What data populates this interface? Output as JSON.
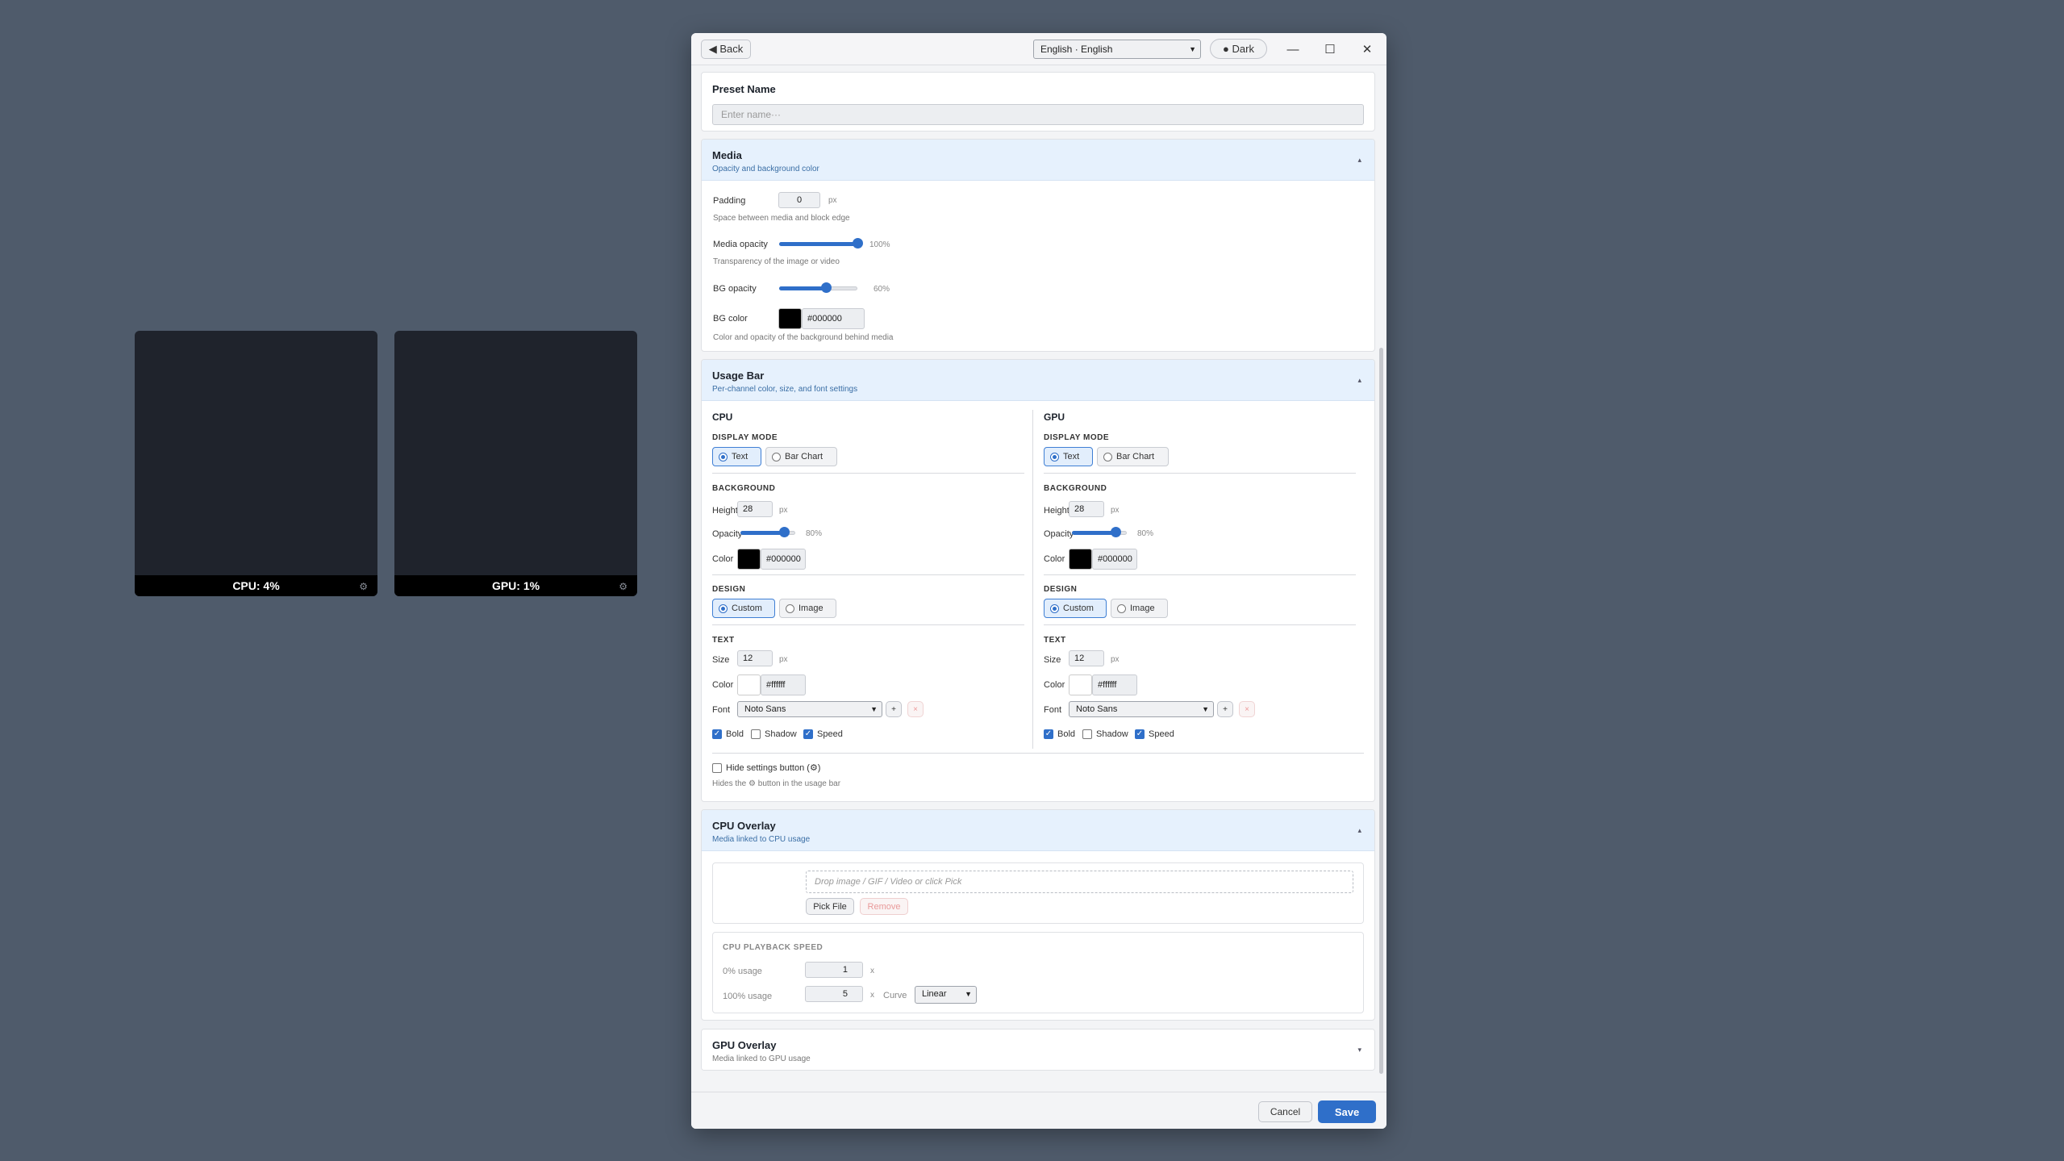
{
  "widgets": {
    "cpu_label": "CPU: 4%",
    "gpu_label": "GPU: 1%",
    "settings_icon": "⚙"
  },
  "titlebar": {
    "back_label": "◀ Back",
    "language_value": "English · English",
    "theme_label": "● Dark",
    "minimize": "—",
    "maximize": "☐",
    "close": "✕"
  },
  "preset": {
    "title": "Preset Name",
    "placeholder": "Enter name···"
  },
  "media": {
    "title": "Media",
    "subtitle": "Opacity and background color",
    "padding_label": "Padding",
    "padding_value": "0",
    "padding_unit": "px",
    "padding_hint": "Space between media and block edge",
    "opacity_label": "Media opacity",
    "opacity_value": "100%",
    "opacity_level": 1.0,
    "opacity_hint": "Transparency of the image or video",
    "bg_opacity_label": "BG opacity",
    "bg_opacity_value": "60%",
    "bg_opacity_level": 0.6,
    "bg_color_label": "BG color",
    "bg_color_value": "#000000",
    "bg_color_hint": "Color and opacity of the background behind media"
  },
  "usage_bar": {
    "title": "Usage Bar",
    "subtitle": "Per-channel color, size, and font settings",
    "channels": [
      {
        "name": "CPU",
        "display_mode_title": "DISPLAY MODE",
        "mode_text": "Text",
        "mode_bar": "Bar Chart",
        "background_title": "BACKGROUND",
        "height_label": "Height",
        "height_value": "28",
        "px": "px",
        "opacity_label": "Opacity",
        "opacity_value": "80%",
        "opacity_level": 0.8,
        "color_label": "Color",
        "color_value": "#000000",
        "design_title": "DESIGN",
        "design_custom": "Custom",
        "design_image": "Image",
        "text_title": "TEXT",
        "size_label": "Size",
        "size_value": "12",
        "text_color_label": "Color",
        "text_color_value": "#ffffff",
        "font_label": "Font",
        "font_value": "Noto Sans",
        "add": "+",
        "remove": "×",
        "bold": "Bold",
        "shadow": "Shadow",
        "speed": "Speed"
      },
      {
        "name": "GPU",
        "display_mode_title": "DISPLAY MODE",
        "mode_text": "Text",
        "mode_bar": "Bar Chart",
        "background_title": "BACKGROUND",
        "height_label": "Height",
        "height_value": "28",
        "px": "px",
        "opacity_label": "Opacity",
        "opacity_value": "80%",
        "opacity_level": 0.8,
        "color_label": "Color",
        "color_value": "#000000",
        "design_title": "DESIGN",
        "design_custom": "Custom",
        "design_image": "Image",
        "text_title": "TEXT",
        "size_label": "Size",
        "size_value": "12",
        "text_color_label": "Color",
        "text_color_value": "#ffffff",
        "font_label": "Font",
        "font_value": "Noto Sans",
        "add": "+",
        "remove": "×",
        "bold": "Bold",
        "shadow": "Shadow",
        "speed": "Speed"
      }
    ],
    "hide_settings_label": "Hide settings button (⚙)",
    "hide_settings_hint": "Hides the ⚙ button in the usage bar"
  },
  "cpu_overlay": {
    "title": "CPU Overlay",
    "subtitle": "Media linked to CPU usage",
    "drop_placeholder": "Drop image / GIF / Video or click Pick",
    "pick_label": "Pick File",
    "remove_label": "Remove",
    "speed_title": "CPU PLAYBACK SPEED",
    "zero_label": "0% usage",
    "zero_value": "1",
    "hundred_label": "100% usage",
    "hundred_value": "5",
    "x_unit": "x",
    "curve_label": "Curve",
    "curve_value": "Linear"
  },
  "gpu_overlay": {
    "title": "GPU Overlay",
    "subtitle": "Media linked to GPU usage"
  },
  "footer": {
    "cancel_label": "Cancel",
    "save_label": "Save"
  },
  "colors": {
    "accent": "#2f6fc9",
    "desktop": "#4f5b6b",
    "widget": "#1f232c"
  }
}
